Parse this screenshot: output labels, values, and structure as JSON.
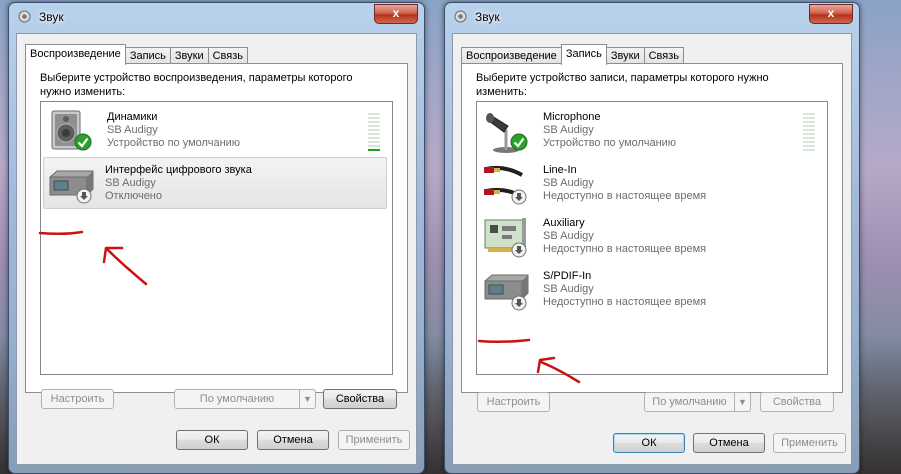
{
  "windows": [
    {
      "title": "Звук",
      "close_label": "x",
      "tabs": [
        "Воспроизведение",
        "Запись",
        "Звуки",
        "Связь"
      ],
      "active_tab": 0,
      "instruction": "Выберите устройство воспроизведения, параметры которого нужно изменить:",
      "devices": [
        {
          "name": "Динамики",
          "driver": "SB Audigy",
          "status": "Устройство по умолчанию",
          "icon": "speaker-icon",
          "badge": "default-check-icon"
        },
        {
          "name": "Интерфейс цифрового звука",
          "driver": "SB Audigy",
          "status": "Отключено",
          "icon": "digital-audio-device-icon",
          "badge": "disabled-arrow-icon"
        }
      ],
      "buttons": {
        "configure": "Настроить",
        "set_default": "По умолчанию",
        "properties": "Свойства"
      },
      "dialog": {
        "ok": "ОК",
        "cancel": "Отмена",
        "apply": "Применить"
      }
    },
    {
      "title": "Звук",
      "close_label": "x",
      "tabs": [
        "Воспроизведение",
        "Запись",
        "Звуки",
        "Связь"
      ],
      "active_tab": 1,
      "instruction": "Выберите устройство записи, параметры которого нужно изменить:",
      "devices": [
        {
          "name": "Microphone",
          "driver": "SB Audigy",
          "status": "Устройство по умолчанию",
          "icon": "microphone-icon",
          "badge": "default-check-icon"
        },
        {
          "name": "Line-In",
          "driver": "SB Audigy",
          "status": "Недоступно в настоящее время",
          "icon": "line-in-cable-icon",
          "badge": "disabled-arrow-icon"
        },
        {
          "name": "Auxiliary",
          "driver": "SB Audigy",
          "status": "Недоступно в настоящее время",
          "icon": "sound-card-icon",
          "badge": "disabled-arrow-icon"
        },
        {
          "name": "S/PDIF-In",
          "driver": "SB Audigy",
          "status": "Недоступно в настоящее время",
          "icon": "digital-audio-device-icon",
          "badge": "disabled-arrow-icon"
        }
      ],
      "buttons": {
        "configure": "Настроить",
        "set_default": "По умолчанию",
        "properties": "Свойства"
      },
      "dialog": {
        "ok": "ОК",
        "cancel": "Отмена",
        "apply": "Применить"
      }
    }
  ],
  "colors": {
    "annotation": "#cc1111",
    "default_check": "#2ca02c",
    "level_meter": "#1ea31e"
  }
}
